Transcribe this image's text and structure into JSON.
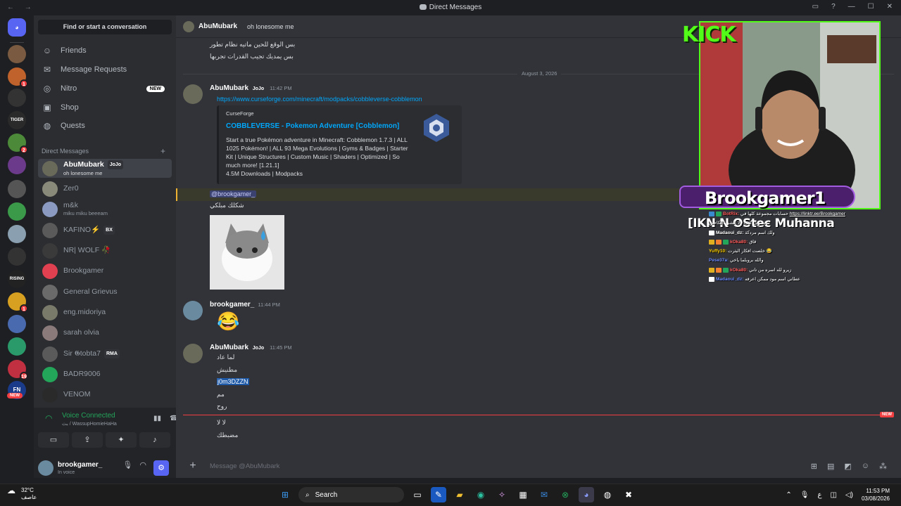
{
  "window": {
    "title": "Direct Messages"
  },
  "colors": {
    "accent": "#5865f2",
    "online": "#23a55a",
    "link": "#00a8fc",
    "danger": "#f23f42",
    "kick_green": "#53fc18"
  },
  "sidebar": {
    "find_placeholder": "Find or start a conversation",
    "nav": [
      {
        "label": "Friends",
        "icon": "friends-icon"
      },
      {
        "label": "Message Requests",
        "icon": "mail-icon"
      },
      {
        "label": "Nitro",
        "icon": "nitro-icon",
        "badge": "NEW"
      },
      {
        "label": "Shop",
        "icon": "shop-icon"
      },
      {
        "label": "Quests",
        "icon": "quests-icon"
      }
    ],
    "dm_header": "Direct Messages",
    "dms": [
      {
        "name": "AbuMubark",
        "tag": "JoJo",
        "sub": "oh lonesome me"
      },
      {
        "name": "Zer0",
        "tag": "",
        "sub": ""
      },
      {
        "name": "m&k",
        "tag": "",
        "sub": "miku miku beeeam"
      },
      {
        "name": "KAFINO⚡",
        "tag": "BX",
        "sub": ""
      },
      {
        "name": "NR| WOLF 🥀",
        "tag": "",
        "sub": ""
      },
      {
        "name": "Brookgamer",
        "tag": "",
        "sub": ""
      },
      {
        "name": "General Grievus",
        "tag": "",
        "sub": ""
      },
      {
        "name": "eng.midoriya",
        "tag": "",
        "sub": ""
      },
      {
        "name": "sarah olvia",
        "tag": "",
        "sub": ""
      },
      {
        "name": "Sir 𝕲tobta7",
        "tag": "RMA",
        "sub": ""
      },
      {
        "name": "BADR9006",
        "tag": "",
        "sub": ""
      },
      {
        "name": "VENOM",
        "tag": "",
        "sub": ""
      }
    ]
  },
  "voice": {
    "status": "Voice Connected",
    "channel": "بث / WassupHomieHaHa"
  },
  "user": {
    "name": "brookgamer_",
    "status": "In voice"
  },
  "chat": {
    "header_name": "AbuMubark",
    "header_status": "oh lonesome me",
    "early_lines": [
      "بس الوقع للحين ماتيه نظام تطور",
      "بس يمديك تجيب القدرات تجربها"
    ],
    "date_divider": "August 3, 2026",
    "messages": [
      {
        "author": "AbuMubark",
        "tag": "JoJo",
        "time": "11:42 PM",
        "link": "https://www.curseforge.com/minecraft/modpacks/cobbleverse-cobblemon",
        "embed": {
          "provider": "CurseForge",
          "title": "COBBLEVERSE - Pokemon Adventure [Cobblemon]",
          "description": "Start a true Pokémon adventure in Minecraft: Cobblemon 1.7.3 | ALL 1025 Pokémon! | ALL 93 Mega Evolutions | Gyms & Badges | Starter Kit | Unique Structures | Custom Music | Shaders | Optimized | So much more! [1.21.1]",
          "stats": "4.5M Downloads | Modpacks"
        }
      },
      {
        "mention": "@brookgamer_",
        "text": "شكلك مبلكي"
      },
      {
        "author": "brookgamer_",
        "time": "11:44 PM",
        "emoji": "😂"
      },
      {
        "author": "AbuMubark",
        "tag": "JoJo",
        "time": "11:45 PM",
        "lines": [
          "لما عاد",
          "مطنيش",
          "j0m3DZZN",
          "مم",
          "روح"
        ]
      }
    ],
    "new_badge": "NEW",
    "after_new": [
      "لا لا",
      "مضبطك"
    ],
    "composer_placeholder": "Message @AbuMubark"
  },
  "stream_overlay": {
    "brand": "KICK",
    "streamer": "Brookgamer1",
    "marquee": "[IKN  N  OSteє Muhanna",
    "chat": [
      {
        "user": "BotRix:",
        "text": "حسابات مجموعة كلها في",
        "link": "https://linktr.ee/Brookgamer"
      },
      {
        "user": "",
        "text": "تسويل كيف ولا الشي :الكاحتن"
      },
      {
        "user": "Madaoui_dz:",
        "text": "ولك اسم مردكة"
      },
      {
        "user": "kOka80:",
        "text": "قاق"
      },
      {
        "user": "Yuffy10:",
        "text": "خلصت افكار البثرت 😂"
      },
      {
        "user": "Pese37a:",
        "text": "والله بروبلما ياخي"
      },
      {
        "user": "kOka80:",
        "text": "زيرو لله اسره من تاني"
      },
      {
        "user": "Madaoui_dz:",
        "text": "عطاني اسم مود ممكن اعرفه"
      }
    ]
  },
  "taskbar": {
    "weather_temp": "32°C",
    "weather_desc": "عاصف",
    "search": "Search",
    "lang": "ع",
    "time": "11:53 PM",
    "date": "03/08/2026"
  }
}
